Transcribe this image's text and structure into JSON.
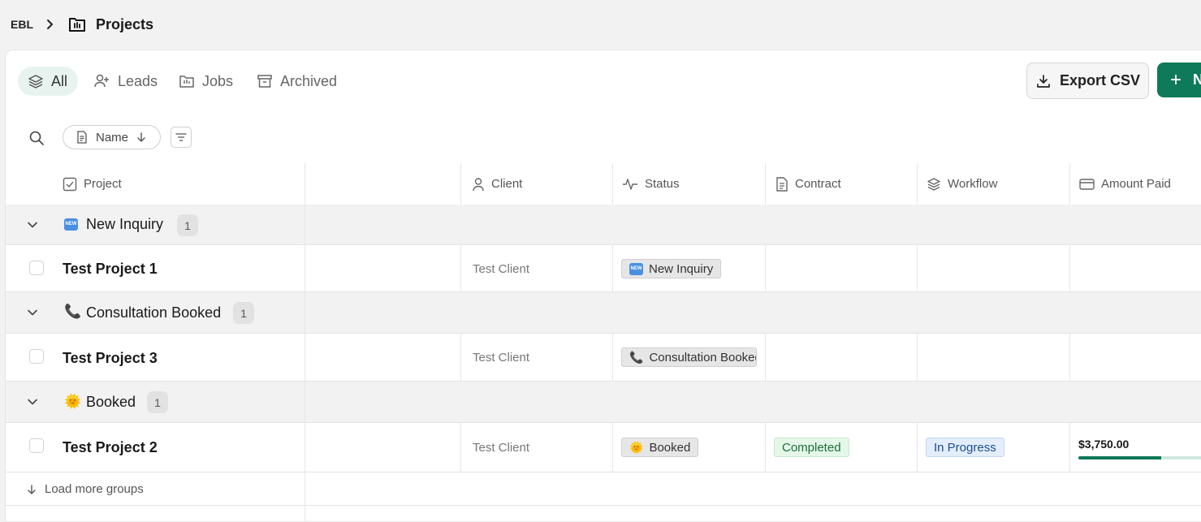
{
  "breadcrumb": {
    "root": "EBL",
    "title": "Projects"
  },
  "tabs": [
    {
      "label": "All",
      "icon": "layers-icon",
      "active": true
    },
    {
      "label": "Leads",
      "icon": "user-plus-icon"
    },
    {
      "label": "Jobs",
      "icon": "folder-icon"
    },
    {
      "label": "Archived",
      "icon": "archive-icon"
    }
  ],
  "toolbar": {
    "export_label": "Export CSV",
    "new_label": "N"
  },
  "sort": {
    "label": "Name"
  },
  "columns": [
    {
      "label": "Project",
      "icon": "checkbox-icon"
    },
    {
      "label": "Client",
      "icon": "user-icon"
    },
    {
      "label": "Status",
      "icon": "activity-icon"
    },
    {
      "label": "Contract",
      "icon": "document-icon"
    },
    {
      "label": "Workflow",
      "icon": "layers-icon"
    },
    {
      "label": "Amount Paid",
      "icon": "credit-card-icon"
    }
  ],
  "groups": [
    {
      "label": "New Inquiry",
      "emoji": "🆕",
      "count": "1",
      "rows": [
        {
          "name": "Test Project 1",
          "client": "Test Client",
          "status": "New Inquiry",
          "status_emoji": "🆕"
        }
      ]
    },
    {
      "label": "Consultation Booked",
      "emoji": "📞",
      "count": "1",
      "rows": [
        {
          "name": "Test Project 3",
          "client": "Test Client",
          "status": "Consultation Booked",
          "status_emoji": "📞"
        }
      ]
    },
    {
      "label": "Booked",
      "emoji": "🌞",
      "count": "1",
      "rows": [
        {
          "name": "Test Project 2",
          "client": "Test Client",
          "status": "Booked",
          "status_emoji": "🌞",
          "contract": "Completed",
          "workflow": "In Progress",
          "amount_paid": "$3,750.00",
          "paid_fraction": 0.64
        }
      ]
    }
  ],
  "load_more": "Load more groups",
  "colors": {
    "accent": "#0f7a5a",
    "group_bg": "#f2f2f2",
    "completed": "#1d6e37",
    "in_progress": "#1d4e96"
  }
}
